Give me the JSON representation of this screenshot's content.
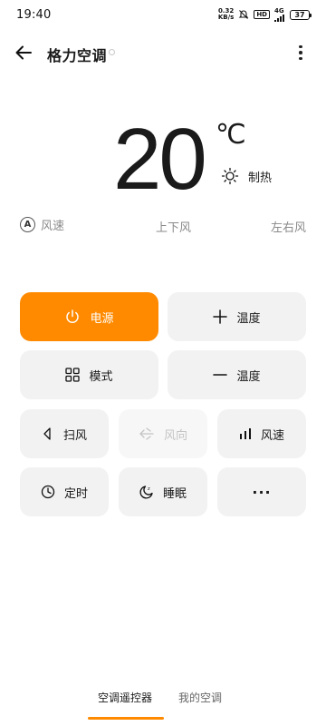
{
  "status_bar": {
    "time": "19:40",
    "net_speed_value": "0.32",
    "net_speed_unit": "KB/s",
    "hd_label": "HD",
    "signal_label": "4G",
    "battery": "37"
  },
  "header": {
    "title": "格力空调"
  },
  "temperature": {
    "value": "20",
    "unit": "℃",
    "mode_label": "制热"
  },
  "labels": {
    "a_badge": "A",
    "fan_speed": "风速",
    "vertical_swing": "上下风",
    "horizontal_swing": "左右风"
  },
  "buttons": {
    "power": "电源",
    "temp_up": "温度",
    "mode": "模式",
    "temp_down": "温度",
    "swing": "扫风",
    "direction": "风向",
    "speed": "风速",
    "timer": "定时",
    "sleep": "睡眠",
    "more": "···"
  },
  "tabs": [
    {
      "label": "空调遥控器",
      "active": true
    },
    {
      "label": "我的空调",
      "active": false
    }
  ],
  "colors": {
    "accent": "#ff8a00",
    "button_bg": "#f2f2f2",
    "disabled_text": "#c4c4c4"
  }
}
